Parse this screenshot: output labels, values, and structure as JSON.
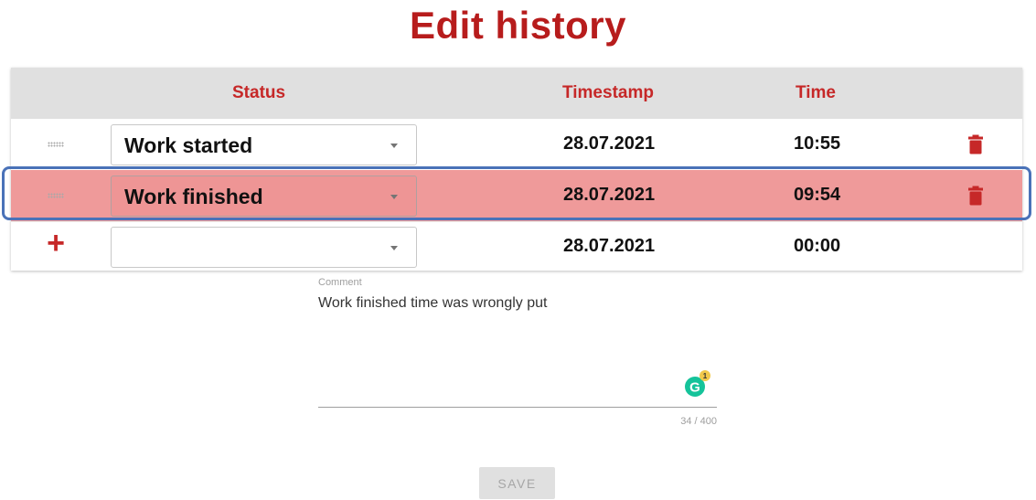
{
  "page": {
    "title": "Edit history"
  },
  "table": {
    "headers": {
      "status": "Status",
      "timestamp": "Timestamp",
      "time": "Time"
    },
    "rows": [
      {
        "status": "Work started",
        "timestamp": "28.07.2021",
        "time": "10:55",
        "highlighted": false
      },
      {
        "status": "Work finished",
        "timestamp": "28.07.2021",
        "time": "09:54",
        "highlighted": true
      },
      {
        "status": "",
        "timestamp": "28.07.2021",
        "time": "00:00",
        "new_row": true
      }
    ]
  },
  "comment": {
    "label": "Comment",
    "value": "Work finished time was wrongly put",
    "counter": "34 / 400",
    "assistant_badge": "1"
  },
  "actions": {
    "save_label": "SAVE"
  },
  "colors": {
    "accent": "#c62828",
    "highlight_row": "#ef9a9a",
    "focus_outline": "#4a72b8",
    "header_bg": "#e0e0e0",
    "grammarly": "#15c39a"
  },
  "icons": {
    "drag": "drag-handle-icon",
    "delete": "trash-icon",
    "add": "plus-icon",
    "dropdown": "caret-down-icon",
    "assistant": "grammarly-icon"
  }
}
